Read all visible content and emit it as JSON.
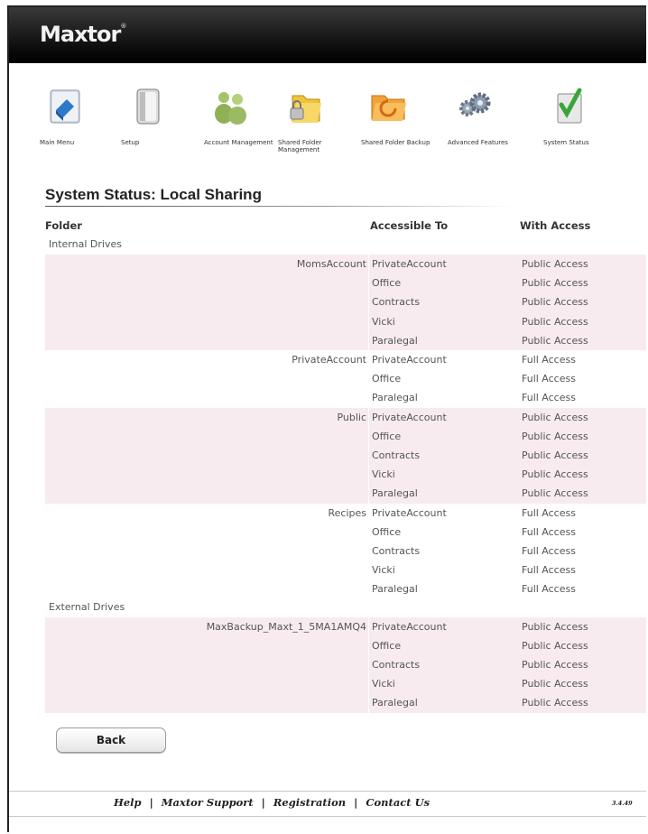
{
  "brand": {
    "logo_text": "Maxtor",
    "logo_mark": "®"
  },
  "nav": [
    {
      "label": "Main Menu",
      "icon": "main-menu-icon"
    },
    {
      "label": "Setup",
      "icon": "setup-icon"
    },
    {
      "label": "Account Management",
      "icon": "account-management-icon"
    },
    {
      "label": "Shared Folder Management",
      "icon": "shared-folder-management-icon"
    },
    {
      "label": "Shared Folder Backup",
      "icon": "shared-folder-backup-icon"
    },
    {
      "label": "Advanced Features",
      "icon": "advanced-features-icon"
    },
    {
      "label": "System Status",
      "icon": "system-status-icon"
    }
  ],
  "page": {
    "title": "System Status: Local Sharing",
    "columns": {
      "folder": "Folder",
      "accessible_to": "Accessible To",
      "with_access": "With Access"
    }
  },
  "groups": [
    {
      "label": "Internal Drives",
      "folders": [
        {
          "name": "MomsAccount",
          "entries": [
            [
              "PrivateAccount",
              "Public Access"
            ],
            [
              "Office",
              "Public Access"
            ],
            [
              "Contracts",
              "Public Access"
            ],
            [
              "Vicki",
              "Public Access"
            ],
            [
              "Paralegal",
              "Public Access"
            ]
          ]
        },
        {
          "name": "PrivateAccount",
          "entries": [
            [
              "PrivateAccount",
              "Full Access"
            ],
            [
              "Office",
              "Full Access"
            ],
            [
              "Paralegal",
              "Full Access"
            ]
          ]
        },
        {
          "name": "Public",
          "entries": [
            [
              "PrivateAccount",
              "Public Access"
            ],
            [
              "Office",
              "Public Access"
            ],
            [
              "Contracts",
              "Public Access"
            ],
            [
              "Vicki",
              "Public Access"
            ],
            [
              "Paralegal",
              "Public Access"
            ]
          ]
        },
        {
          "name": "Recipes",
          "entries": [
            [
              "PrivateAccount",
              "Full Access"
            ],
            [
              "Office",
              "Full Access"
            ],
            [
              "Contracts",
              "Full Access"
            ],
            [
              "Vicki",
              "Full Access"
            ],
            [
              "Paralegal",
              "Full Access"
            ]
          ]
        }
      ]
    },
    {
      "label": "External Drives",
      "folders": [
        {
          "name": "MaxBackup_Maxt_1_5MA1AMQ4",
          "entries": [
            [
              "PrivateAccount",
              "Public Access"
            ],
            [
              "Office",
              "Public Access"
            ],
            [
              "Contracts",
              "Public Access"
            ],
            [
              "Vicki",
              "Public Access"
            ],
            [
              "Paralegal",
              "Public Access"
            ]
          ]
        }
      ]
    }
  ],
  "actions": {
    "back_label": "Back"
  },
  "footer": {
    "links": [
      "Help",
      "Maxtor Support",
      "Registration",
      "Contact Us"
    ],
    "separator": "|",
    "version": "3.4.49"
  },
  "colors": {
    "band": "#f7ebf0",
    "header": "#000000"
  }
}
